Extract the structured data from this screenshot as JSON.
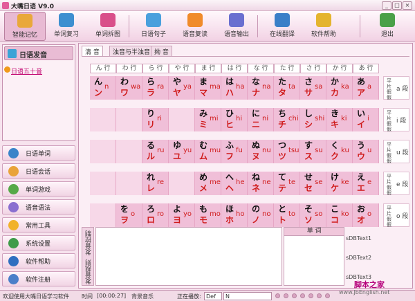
{
  "window": {
    "title": "大嘴日语 V9.0",
    "min": "_",
    "max": "□",
    "close": "×"
  },
  "toolbar": [
    {
      "label": "智能记忆",
      "icon": "memory-icon",
      "color": "#e9a83a"
    },
    {
      "label": "单词复习",
      "icon": "review-icon",
      "color": "#3e8fd0"
    },
    {
      "label": "单词拆图",
      "icon": "split-icon",
      "color": "#d94f8a"
    },
    {
      "label": "日语句子",
      "icon": "sentence-icon",
      "color": "#4aa0dd"
    },
    {
      "label": "语音复读",
      "icon": "repeat-icon",
      "color": "#f08b2a"
    },
    {
      "label": "语音输出",
      "icon": "speaker-icon",
      "color": "#6a6fd0"
    },
    {
      "label": "在线翻译",
      "icon": "globe-icon",
      "color": "#3a7fc8"
    },
    {
      "label": "软件帮助",
      "icon": "help-icon",
      "color": "#e4b42e"
    },
    {
      "label": "退出",
      "icon": "exit-icon",
      "color": "#4aa048"
    }
  ],
  "sidebar": {
    "header": "日语发音",
    "sub_item": "日语五十音",
    "menu": [
      {
        "label": "日语单词",
        "color": "#3a84c9"
      },
      {
        "label": "日语会话",
        "color": "#e9a33a"
      },
      {
        "label": "单词游戏",
        "color": "#56a948"
      },
      {
        "label": "语音语法",
        "color": "#8a6fd0"
      },
      {
        "label": "常用工具",
        "color": "#f1b22b"
      },
      {
        "label": "系统设置",
        "color": "#3f9b4a"
      },
      {
        "label": "软件帮助",
        "color": "#2f6fc0"
      },
      {
        "label": "软件注册",
        "color": "#4a7fc9"
      }
    ]
  },
  "tabs": [
    "清 音",
    "浊音与半浊音",
    "拗 音"
  ],
  "columns": [
    "ん 行",
    "わ 行",
    "ら 行",
    "や 行",
    "ま 行",
    "は 行",
    "な 行",
    "た 行",
    "さ 行",
    "か 行",
    "あ 行"
  ],
  "rows": [
    {
      "k": "平片假假",
      "dan": "a 段"
    },
    {
      "k": "平片假假",
      "dan": "i 段"
    },
    {
      "k": "平片假假",
      "dan": "u 段"
    },
    {
      "k": "平片假假",
      "dan": "e 段"
    },
    {
      "k": "平片假假",
      "dan": "o 段"
    }
  ],
  "grid": [
    [
      [
        "ん",
        "ン",
        "n"
      ],
      [
        "わ",
        "ワ",
        "wa"
      ],
      [
        "ら",
        "ラ",
        "ra"
      ],
      [
        "や",
        "ヤ",
        "ya"
      ],
      [
        "ま",
        "マ",
        "ma"
      ],
      [
        "は",
        "ハ",
        "ha"
      ],
      [
        "な",
        "ナ",
        "na"
      ],
      [
        "た",
        "タ",
        "ta"
      ],
      [
        "さ",
        "サ",
        "sa"
      ],
      [
        "か",
        "カ",
        "ka"
      ],
      [
        "あ",
        "ア",
        "a"
      ]
    ],
    [
      null,
      null,
      [
        "り",
        "リ",
        "ri"
      ],
      null,
      [
        "み",
        "ミ",
        "mi"
      ],
      [
        "ひ",
        "ヒ",
        "hi"
      ],
      [
        "に",
        "ニ",
        "ni"
      ],
      [
        "ち",
        "チ",
        "chi"
      ],
      [
        "し",
        "シ",
        "shi"
      ],
      [
        "き",
        "キ",
        "ki"
      ],
      [
        "い",
        "イ",
        "i"
      ]
    ],
    [
      null,
      null,
      [
        "る",
        "ル",
        "ru"
      ],
      [
        "ゆ",
        "ユ",
        "yu"
      ],
      [
        "む",
        "ム",
        "mu"
      ],
      [
        "ふ",
        "フ",
        "fu"
      ],
      [
        "ぬ",
        "ヌ",
        "nu"
      ],
      [
        "つ",
        "ツ",
        "tsu"
      ],
      [
        "す",
        "ス",
        "su"
      ],
      [
        "く",
        "ク",
        "ku"
      ],
      [
        "う",
        "ウ",
        "u"
      ]
    ],
    [
      null,
      null,
      [
        "れ",
        "レ",
        "re"
      ],
      null,
      [
        "め",
        "メ",
        "me"
      ],
      [
        "へ",
        "ヘ",
        "he"
      ],
      [
        "ね",
        "ネ",
        "ne"
      ],
      [
        "て",
        "テ",
        "te"
      ],
      [
        "せ",
        "セ",
        "se"
      ],
      [
        "け",
        "ケ",
        "ke"
      ],
      [
        "え",
        "エ",
        "e"
      ]
    ],
    [
      null,
      [
        "を",
        "ヲ",
        "o"
      ],
      [
        "ろ",
        "ロ",
        "ro"
      ],
      [
        "よ",
        "ヨ",
        "yo"
      ],
      [
        "も",
        "モ",
        "mo"
      ],
      [
        "ほ",
        "ホ",
        "ho"
      ],
      [
        "の",
        "ノ",
        "no"
      ],
      [
        "と",
        "ト",
        "to"
      ],
      [
        "そ",
        "ソ",
        "so"
      ],
      [
        "こ",
        "コ",
        "ko"
      ],
      [
        "お",
        "オ",
        "o"
      ]
    ]
  ],
  "bottom": {
    "vtab1": "发音规则",
    "vtab2": "发音控制",
    "word_header": "单 词",
    "sdb1": "sDBText1",
    "sdb2": "sDBText2",
    "sdb3": "sDBText3"
  },
  "status": {
    "welcome": "欢迎使用大嘴日语学习软件",
    "time_label": "时间",
    "time": "[00:00:27]",
    "music": "背景音乐",
    "playing": "正在播放:",
    "def": "Def",
    "n": "N"
  },
  "watermark": {
    "brand": "脚本之家",
    "url": "www.JbEnglish.net"
  }
}
